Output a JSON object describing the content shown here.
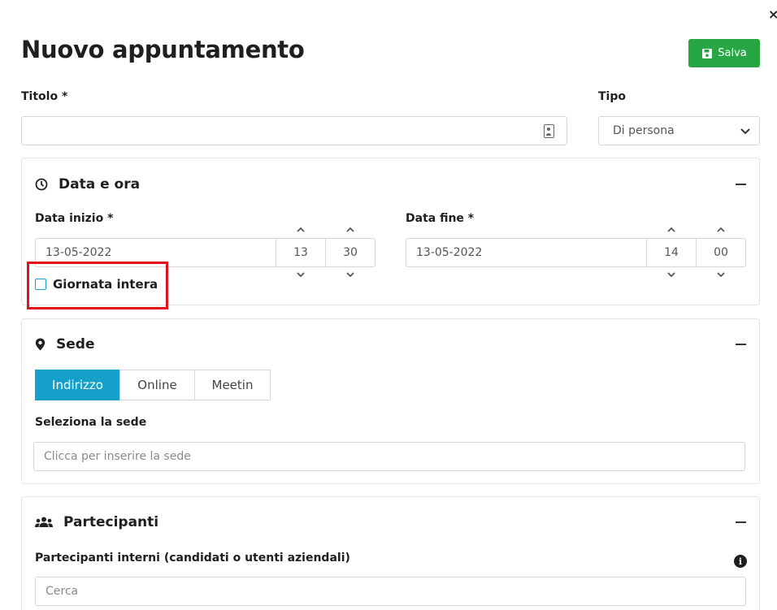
{
  "window": {
    "close_glyph": "×"
  },
  "header": {
    "title": "Nuovo appuntamento",
    "save_label": "Salva"
  },
  "form": {
    "title_label": "Titolo *",
    "title_value": "",
    "type_label": "Tipo",
    "type_value": "Di persona"
  },
  "date_section": {
    "heading": "Data e ora",
    "start_label": "Data inizio *",
    "start_date": "13-05-2022",
    "start_hour": "13",
    "start_minute": "30",
    "end_label": "Data fine *",
    "end_date": "13-05-2022",
    "end_hour": "14",
    "end_minute": "00",
    "all_day_label": "Giornata intera",
    "all_day_checked": false
  },
  "location_section": {
    "heading": "Sede",
    "tabs": [
      {
        "label": "Indirizzo",
        "active": true
      },
      {
        "label": "Online",
        "active": false
      },
      {
        "label": "Meetin",
        "active": false
      }
    ],
    "select_label": "Seleziona la sede",
    "select_placeholder": "Clicca per inserire la sede"
  },
  "participants_section": {
    "heading": "Partecipanti",
    "internal_label": "Partecipanti interni (candidati o utenti aziendali)",
    "search_placeholder": "Cerca"
  },
  "colors": {
    "save_button": "#27a744",
    "active_tab": "#14a0c8",
    "highlight_border": "#e3131b"
  },
  "icons": [
    "save-icon",
    "contact-icon",
    "chevron-down-icon",
    "clock-icon",
    "minus-icon",
    "chevron-up-icon",
    "map-pin-icon",
    "users-icon",
    "info-icon"
  ]
}
